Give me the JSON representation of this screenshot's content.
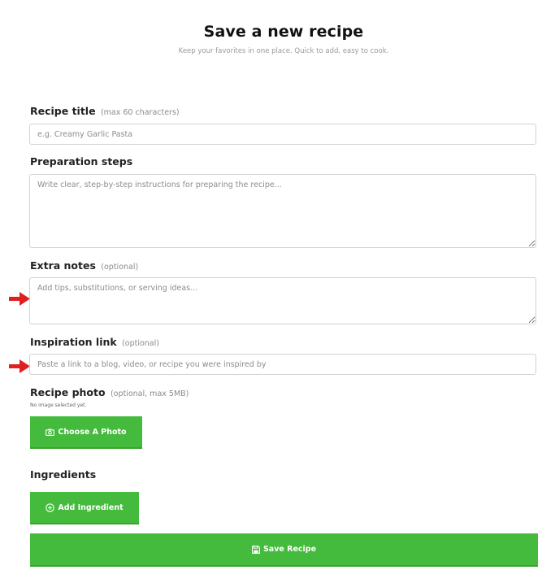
{
  "header": {
    "title": "Save a new recipe",
    "subtitle": "Keep your favorites in one place. Quick to add, easy to cook."
  },
  "form": {
    "recipe_title": {
      "label": "Recipe title",
      "hint": "(max 60 characters)",
      "placeholder": "e.g. Creamy Garlic Pasta",
      "value": ""
    },
    "preparation_steps": {
      "label": "Preparation steps",
      "placeholder": "Write clear, step-by-step instructions for preparing the recipe...",
      "value": ""
    },
    "extra_notes": {
      "label": "Extra notes",
      "hint": "(optional)",
      "placeholder": "Add tips, substitutions, or serving ideas...",
      "value": ""
    },
    "inspiration_link": {
      "label": "Inspiration link",
      "hint": "(optional)",
      "placeholder": "Paste a link to a blog, video, or recipe you were inspired by",
      "value": ""
    },
    "recipe_photo": {
      "label": "Recipe photo",
      "hint": "(optional, max 5MB)",
      "status": "No image selected yet.",
      "button_label": "Choose A Photo",
      "button_icon": "camera-icon"
    },
    "ingredients": {
      "label": "Ingredients",
      "button_label": "Add Ingredient",
      "button_icon": "plus-circle-icon"
    },
    "save": {
      "button_label": "Save Recipe",
      "button_icon": "floppy-disk-icon"
    }
  },
  "annotations": {
    "arrow_color": "#e02020",
    "arrow_icon": "arrow-right-icon"
  },
  "colors": {
    "accent": "#44bb3c",
    "field_border": "#d2d2d2",
    "hint_text": "#8a8a8a"
  }
}
